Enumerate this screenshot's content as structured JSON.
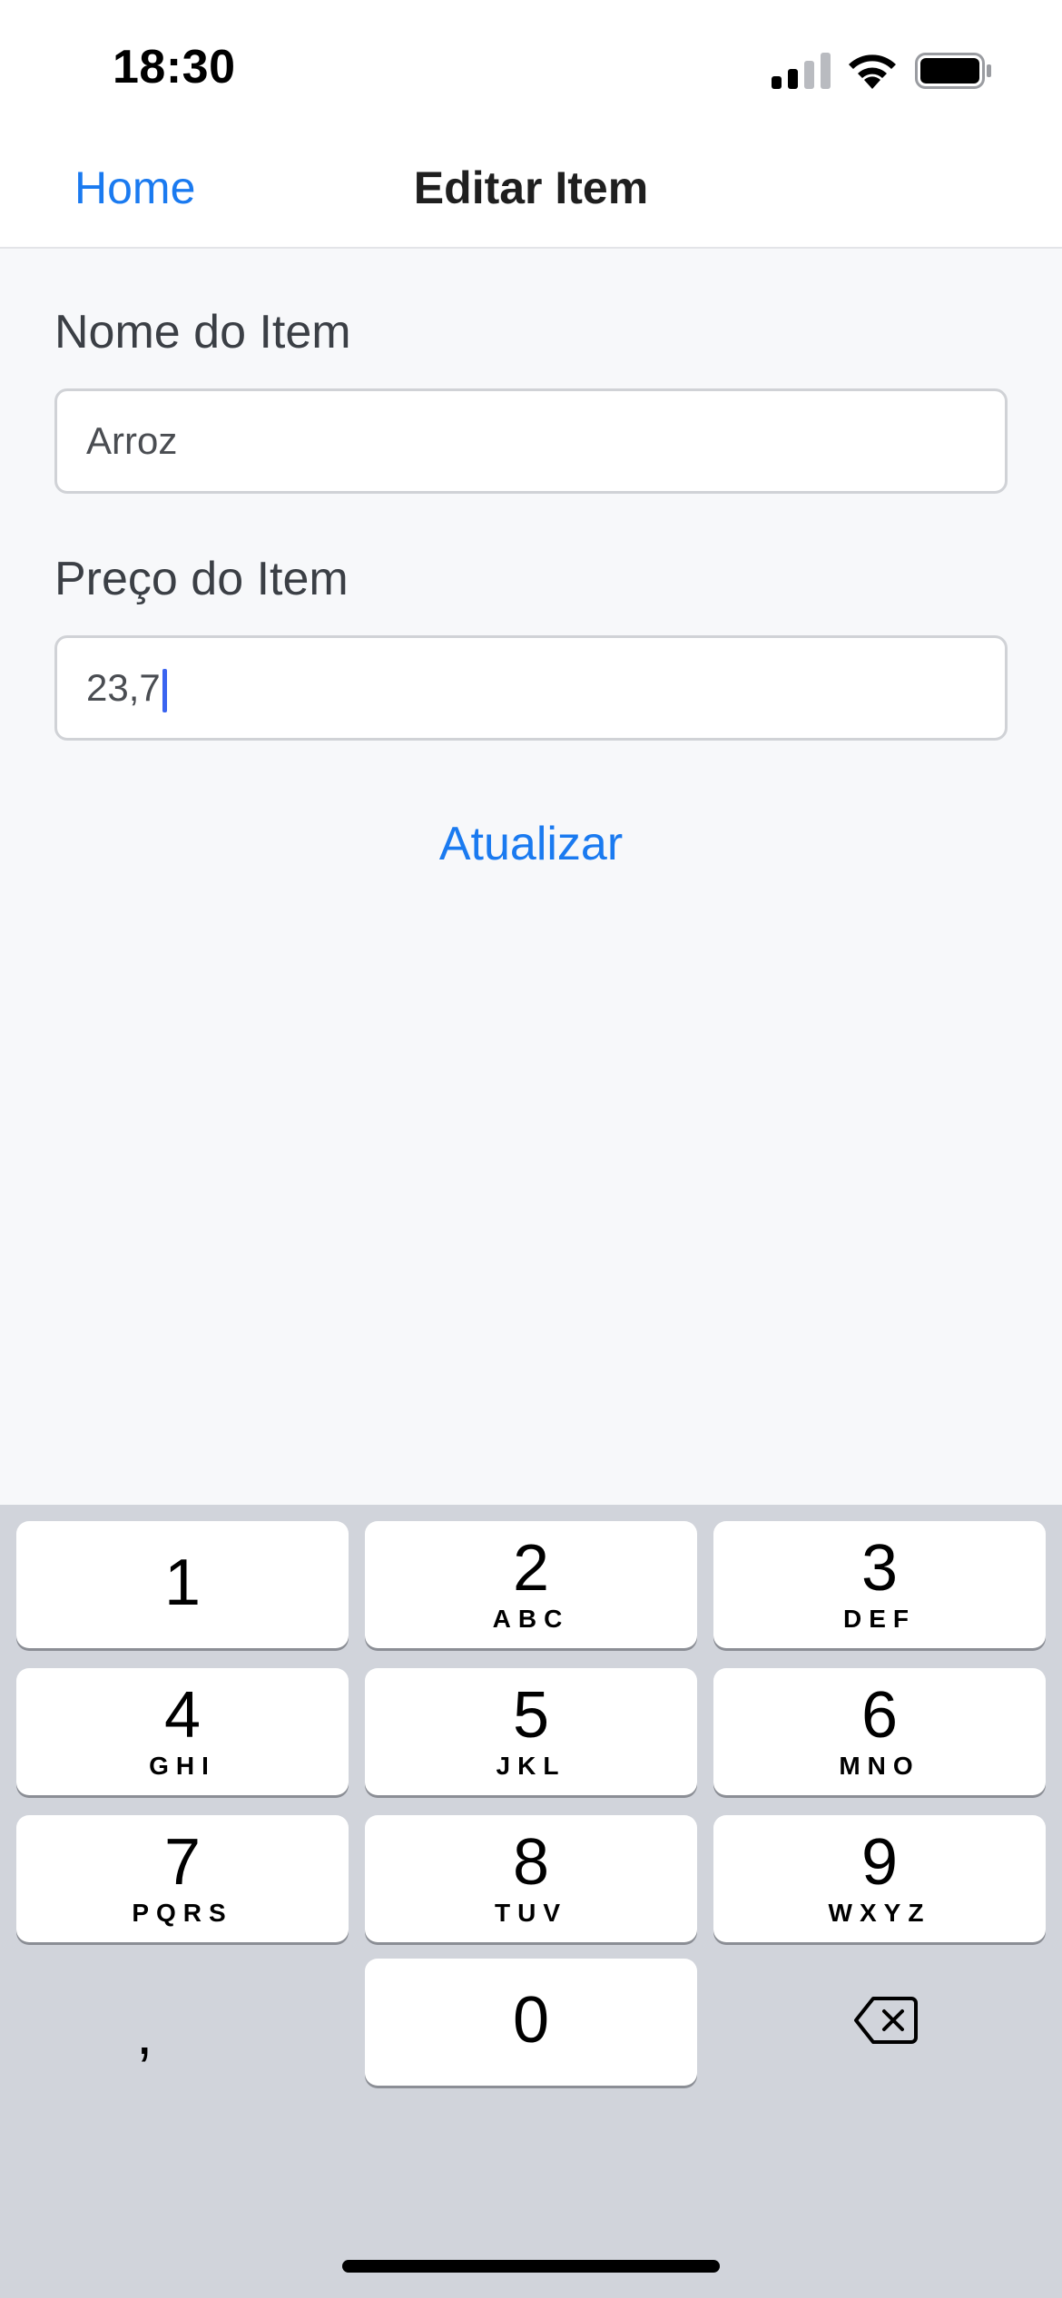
{
  "status_bar": {
    "time": "18:30",
    "icons": [
      "signal-icon",
      "wifi-icon",
      "battery-icon"
    ]
  },
  "nav": {
    "back_label": "Home",
    "title": "Editar Item"
  },
  "form": {
    "name_label": "Nome do Item",
    "name_value": "Arroz",
    "price_label": "Preço do Item",
    "price_value": "23,7",
    "submit_label": "Atualizar"
  },
  "keyboard": {
    "keys": [
      {
        "digit": "1",
        "letters": ""
      },
      {
        "digit": "2",
        "letters": "ABC"
      },
      {
        "digit": "3",
        "letters": "DEF"
      },
      {
        "digit": "4",
        "letters": "GHI"
      },
      {
        "digit": "5",
        "letters": "JKL"
      },
      {
        "digit": "6",
        "letters": "MNO"
      },
      {
        "digit": "7",
        "letters": "PQRS"
      },
      {
        "digit": "8",
        "letters": "TUV"
      },
      {
        "digit": "9",
        "letters": "WXYZ"
      },
      {
        "digit": "0",
        "letters": ""
      }
    ],
    "comma": ",",
    "delete_icon": "backspace-icon"
  },
  "colors": {
    "accent": "#1a7af0",
    "background": "#f7f8fa",
    "keyboard_bg": "#d1d4db",
    "caret": "#3a64f0"
  }
}
